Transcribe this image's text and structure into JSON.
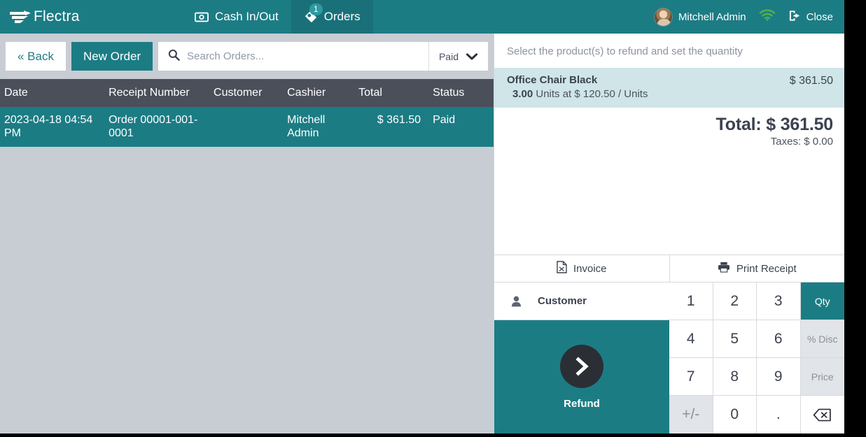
{
  "header": {
    "brand": "Flectra",
    "brand_icon": "flectra-logo-icon",
    "tabs": [
      {
        "label": "Cash In/Out",
        "icon": "cash-icon",
        "active": false,
        "badge": ""
      },
      {
        "label": "Orders",
        "icon": "order-ticket-icon",
        "active": true,
        "badge": "1"
      }
    ],
    "user_name": "Mitchell Admin",
    "user_avatar_icon": "avatar",
    "wifi_icon": "wifi-icon",
    "close_label": "Close",
    "close_icon": "logout-icon",
    "colors": {
      "teal": "#1c7c84",
      "tab_active": "#1a7079",
      "badge": "#2e9aa2",
      "wifi": "#4caf50"
    }
  },
  "toolbar": {
    "back_label": "« Back",
    "new_order_label": "New Order",
    "search_placeholder": "Search Orders...",
    "search_value": "",
    "search_icon": "search-icon",
    "filter_label": "Paid",
    "filter_icon": "chevron-down-icon"
  },
  "orders_table": {
    "columns": [
      "Date",
      "Receipt Number",
      "Customer",
      "Cashier",
      "Total",
      "Status"
    ],
    "rows": [
      {
        "date": "2023-04-18 04:54 PM",
        "receipt": "Order 00001-001-0001",
        "customer": "",
        "cashier": "Mitchell Admin",
        "total": "$ 361.50",
        "status": "Paid",
        "selected": true
      }
    ]
  },
  "refund_panel": {
    "hint": "Select the product(s) to refund and set the quantity",
    "product": {
      "name": "Office Chair Black",
      "qty": "3.00",
      "qty_detail": "Units at $ 120.50 / Units",
      "price": "$ 361.50"
    },
    "total_label": "Total: $ 361.50",
    "taxes_label": "Taxes: $ 0.00",
    "actions": [
      {
        "label": "Invoice",
        "icon": "pdf-file-icon"
      },
      {
        "label": "Print Receipt",
        "icon": "printer-icon"
      }
    ],
    "customer_button": {
      "label": "Customer",
      "icon": "person-icon"
    },
    "refund_button": {
      "label": "Refund",
      "icon": "chevron-right-circle-icon"
    },
    "numpad": {
      "keys": [
        "1",
        "2",
        "3",
        "4",
        "5",
        "6",
        "7",
        "8",
        "9",
        "+/-",
        "0",
        "."
      ],
      "modes": [
        {
          "label": "Qty",
          "active": true
        },
        {
          "label": "% Disc",
          "active": false
        },
        {
          "label": "Price",
          "active": false
        }
      ],
      "backspace_icon": "backspace-icon"
    }
  }
}
